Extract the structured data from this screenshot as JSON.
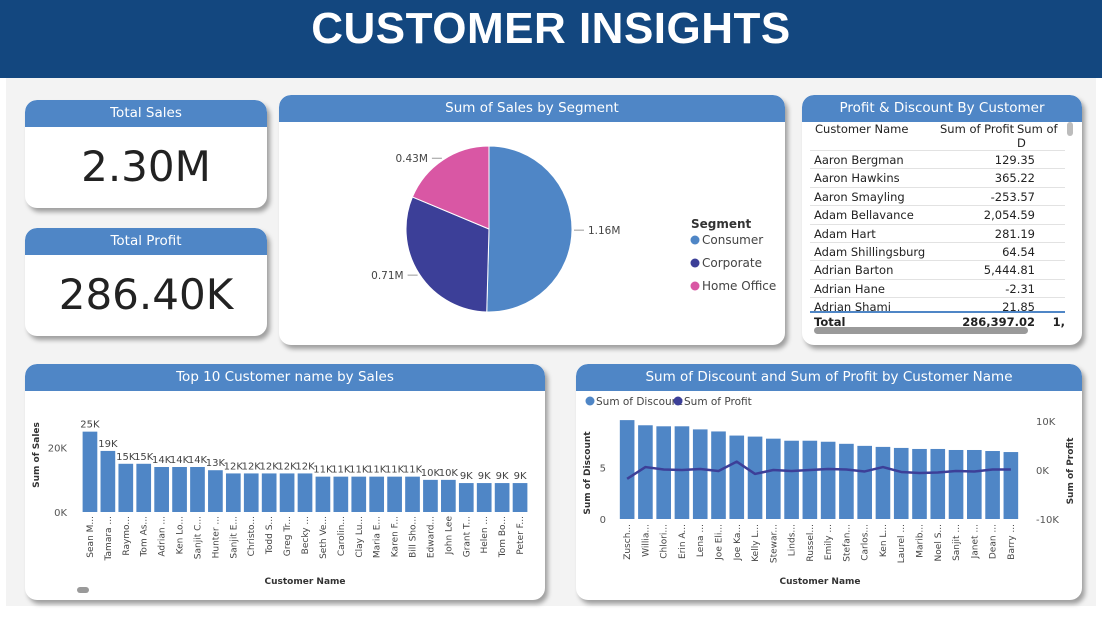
{
  "header": {
    "title": "CUSTOMER INSIGHTS"
  },
  "kpis": {
    "total_sales": {
      "label": "Total Sales",
      "value": "2.30M"
    },
    "total_profit": {
      "label": "Total Profit",
      "value": "286.40K"
    }
  },
  "segment_chart": {
    "title": "Sum of Sales by Segment",
    "legend_title": "Segment"
  },
  "profit_table": {
    "title": "Profit & Discount By Customer",
    "columns": [
      "Customer Name",
      "Sum of Profit",
      "Sum of D"
    ],
    "rows": [
      {
        "name": "Aaron Bergman",
        "profit": "129.35"
      },
      {
        "name": "Aaron Hawkins",
        "profit": "365.22"
      },
      {
        "name": "Aaron Smayling",
        "profit": "-253.57"
      },
      {
        "name": "Adam Bellavance",
        "profit": "2,054.59"
      },
      {
        "name": "Adam Hart",
        "profit": "281.19"
      },
      {
        "name": "Adam Shillingsburg",
        "profit": "64.54"
      },
      {
        "name": "Adrian Barton",
        "profit": "5,444.81"
      },
      {
        "name": "Adrian Hane",
        "profit": "-2.31"
      },
      {
        "name": "Adrian Shami",
        "profit": "21.85"
      }
    ],
    "total": {
      "label": "Total",
      "profit": "286,397.02",
      "discount": "1,"
    }
  },
  "top10_chart": {
    "title": "Top 10 Customer name by Sales"
  },
  "discount_chart": {
    "title": "Sum of Discount and Sum of Profit by Customer Name"
  },
  "chart_data": [
    {
      "type": "pie",
      "title": "Sum of Sales by Segment",
      "legend_title": "Segment",
      "categories": [
        "Consumer",
        "Corporate",
        "Home Office"
      ],
      "values": [
        1.16,
        0.71,
        0.43
      ],
      "data_labels": [
        "1.16M",
        "0.71M",
        "0.43M"
      ],
      "colors": [
        "#4f86c6",
        "#3c3f98",
        "#d957a4"
      ],
      "legend_position": "right"
    },
    {
      "type": "bar",
      "title": "Top 10 Customer name by Sales",
      "xlabel": "Customer Name",
      "ylabel": "Sum of Sales",
      "yticks": [
        "0K",
        "20K"
      ],
      "ylim": [
        0,
        28000
      ],
      "categories": [
        "Sean M...",
        "Tamara ...",
        "Raymo...",
        "Tom As...",
        "Adrian ...",
        "Ken Lo...",
        "Sanjit C...",
        "Hunter ...",
        "Sanjit E...",
        "Christo...",
        "Todd S...",
        "Greg Tr...",
        "Becky ...",
        "Seth Ve...",
        "Carolin...",
        "Clay Lu...",
        "Maria E...",
        "Karen F...",
        "Bill Sho...",
        "Edward...",
        "John Lee",
        "Grant T...",
        "Helen ...",
        "Tom Bo...",
        "Peter F..."
      ],
      "values": [
        25000,
        19000,
        15000,
        15000,
        14000,
        14000,
        14000,
        13000,
        12000,
        12000,
        12000,
        12000,
        12000,
        11000,
        11000,
        11000,
        11000,
        11000,
        11000,
        10000,
        10000,
        9000,
        9000,
        9000,
        9000
      ],
      "data_labels": [
        "25K",
        "19K",
        "15K",
        "15K",
        "14K",
        "14K",
        "14K",
        "13K",
        "12K",
        "12K",
        "12K",
        "12K",
        "12K",
        "11K",
        "11K",
        "11K",
        "11K",
        "11K",
        "11K",
        "10K",
        "10K",
        "9K",
        "9K",
        "9K",
        "9K"
      ],
      "color": "#4f86c6"
    },
    {
      "type": "bar",
      "title": "Sum of Discount and Sum of Profit by Customer Name",
      "xlabel": "Customer Name",
      "ylabel": "Sum of Discount",
      "y2label": "Sum of Profit",
      "yticks": [
        "0",
        "5"
      ],
      "y2ticks": [
        "10K",
        "0K",
        "-10K"
      ],
      "ylim": [
        0,
        10
      ],
      "y2lim": [
        -10000,
        10000
      ],
      "legend_position": "top-left",
      "categories": [
        "Zusch...",
        "Willia...",
        "Chlori...",
        "Erin A...",
        "Lena ...",
        "Joe Eli...",
        "Joe Ka...",
        "Kelly L...",
        "Stewar...",
        "Linds...",
        "Russel...",
        "Emily ...",
        "Stefan...",
        "Carlos...",
        "Ken L...",
        "Laurel ...",
        "Marib...",
        "Noel S...",
        "Sanjit ...",
        "Janet ...",
        "Dean ...",
        "Barry ..."
      ],
      "series": [
        {
          "name": "Sum of Discount",
          "kind": "bar",
          "color": "#4f86c6",
          "values": [
            9.6,
            9.1,
            9.0,
            9.0,
            8.7,
            8.5,
            8.1,
            8.0,
            7.8,
            7.6,
            7.6,
            7.5,
            7.3,
            7.1,
            7.0,
            6.9,
            6.8,
            6.8,
            6.7,
            6.7,
            6.6,
            6.5
          ]
        },
        {
          "name": "Sum of Profit",
          "kind": "line",
          "color": "#3c3f98",
          "values": [
            -1800,
            600,
            100,
            0,
            200,
            -200,
            1700,
            -800,
            0,
            -200,
            0,
            200,
            100,
            -300,
            600,
            -400,
            -600,
            -500,
            -200,
            -300,
            100,
            100
          ]
        }
      ]
    }
  ]
}
